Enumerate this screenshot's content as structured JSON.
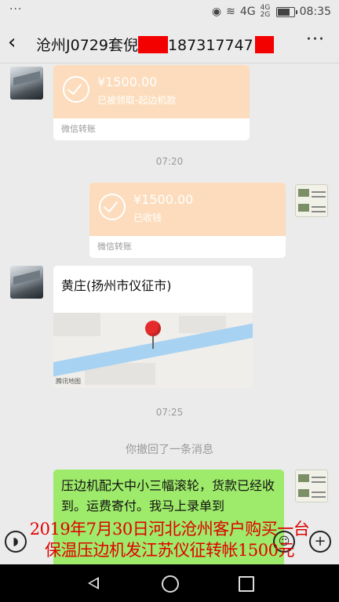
{
  "status_bar": {
    "dots": "···",
    "network": "4G",
    "network2": "4G 2G",
    "time": "08:35"
  },
  "header": {
    "back_icon": "‹",
    "title_prefix": "沧州J0729套倪",
    "title_phone": "187317747",
    "more_icon": "···"
  },
  "messages": {
    "transfer1": {
      "amount": "¥1500.00",
      "status": "已被领取-起边机款",
      "label": "微信转账"
    },
    "time1": "07:20",
    "transfer2": {
      "amount": "¥1500.00",
      "status": "已收钱",
      "label": "微信转账"
    },
    "location": {
      "title": "黄庄(扬州市仪征市)",
      "map_logo": "腾讯地图"
    },
    "time2": "07:25",
    "recall_notice": "你撤回了一条消息",
    "text_message": "压边机配大中小三幅滚轮，货款已经收到。运费寄付。我马上录单到"
  },
  "overlay_caption": {
    "line1": "2019年7月30日河北沧州客户购买一台",
    "line2": "保温压边机发江苏仪征转帐1500元"
  },
  "input_bar": {
    "voice_icon": "voice-icon",
    "emoji_icon": "emoji-icon",
    "plus_icon": "plus-icon"
  },
  "colors": {
    "transfer": "#fcdcbc",
    "my_bubble": "#9eea6a",
    "overlay_text": "#e00000",
    "redaction": "#f30000"
  }
}
